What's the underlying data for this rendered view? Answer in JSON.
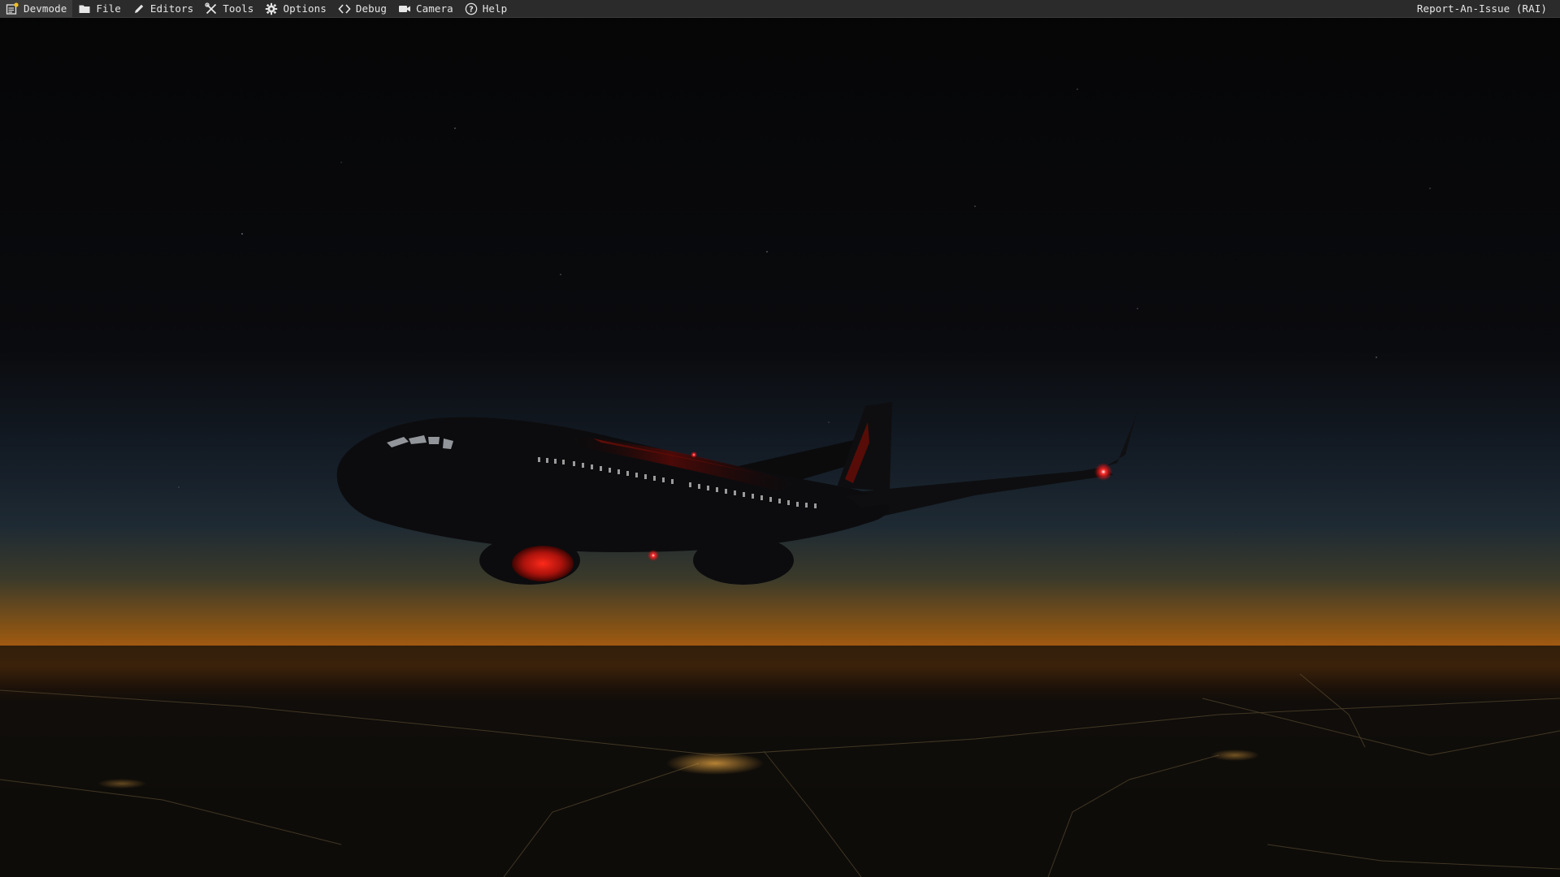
{
  "menubar": {
    "items": [
      {
        "label": "Devmode",
        "icon": "devmode-icon"
      },
      {
        "label": "File",
        "icon": "folder-icon"
      },
      {
        "label": "Editors",
        "icon": "pencil-icon"
      },
      {
        "label": "Tools",
        "icon": "tools-icon"
      },
      {
        "label": "Options",
        "icon": "gear-icon"
      },
      {
        "label": "Debug",
        "icon": "code-icon"
      },
      {
        "label": "Camera",
        "icon": "camera-icon"
      },
      {
        "label": "Help",
        "icon": "help-icon"
      }
    ],
    "report_label": "Report-An-Issue (RAI)"
  },
  "colors": {
    "menubar_bg": "#2b2b2b",
    "menubar_text": "#e6e6e6",
    "sky_top": "#050506",
    "horizon_glow": "#c2620f",
    "nav_light": "#ff2020"
  }
}
